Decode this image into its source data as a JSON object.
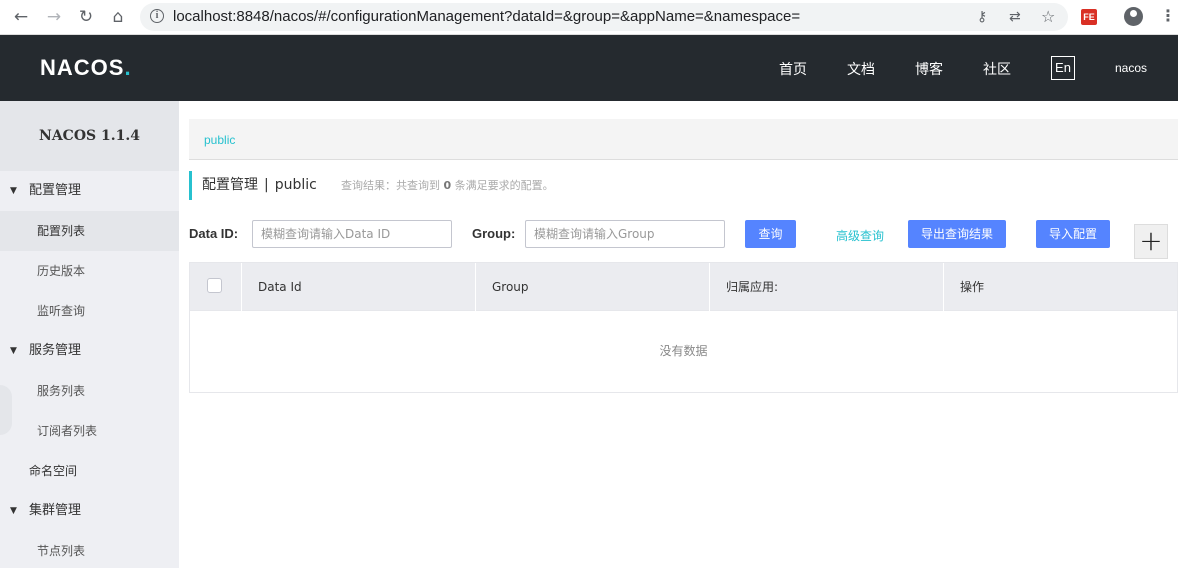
{
  "browser": {
    "url": "localhost:8848/nacos/#/configurationManagement?dataId=&group=&appName=&namespace=",
    "icons": [
      "back-arrow-icon",
      "forward-arrow-icon",
      "reload-icon",
      "home-icon",
      "info-icon",
      "key-icon",
      "translate-icon",
      "star-icon",
      "extension-icon",
      "profile-icon",
      "menu-icon"
    ],
    "ext_label": "FE"
  },
  "header": {
    "logo_text": "NACOS",
    "logo_dot": ".",
    "nav": [
      "首页",
      "文档",
      "博客",
      "社区"
    ],
    "lang": "En",
    "user": "nacos"
  },
  "sidebar": {
    "title": "NACOS 1.1.4",
    "groups": [
      {
        "label": "配置管理",
        "items": [
          "配置列表",
          "历史版本",
          "监听查询"
        ]
      },
      {
        "label": "服务管理",
        "items": [
          "服务列表",
          "订阅者列表"
        ]
      },
      {
        "label": "命名空间"
      },
      {
        "label": "集群管理",
        "items": [
          "节点列表"
        ]
      }
    ]
  },
  "main": {
    "namespace_tab": "public",
    "title": "配置管理",
    "title_sep": "|",
    "title_ns": "public",
    "summary_prefix": "查询结果：共查询到",
    "summary_count": "0",
    "summary_suffix": "条满足要求的配置。",
    "dataid_label": "Data ID:",
    "dataid_placeholder": "模糊查询请输入Data ID",
    "group_label": "Group:",
    "group_placeholder": "模糊查询请输入Group",
    "search_button": "查询",
    "advanced_link": "高级查询",
    "export_button": "导出查询结果",
    "import_button": "导入配置",
    "add_button": "+"
  },
  "table": {
    "columns": [
      "Data Id",
      "Group",
      "归属应用:",
      "操作"
    ],
    "empty_text": "没有数据"
  },
  "colors": {
    "header_bg": "#252a2f",
    "accent": "#27c1cf",
    "primary_button": "#5584ff"
  }
}
